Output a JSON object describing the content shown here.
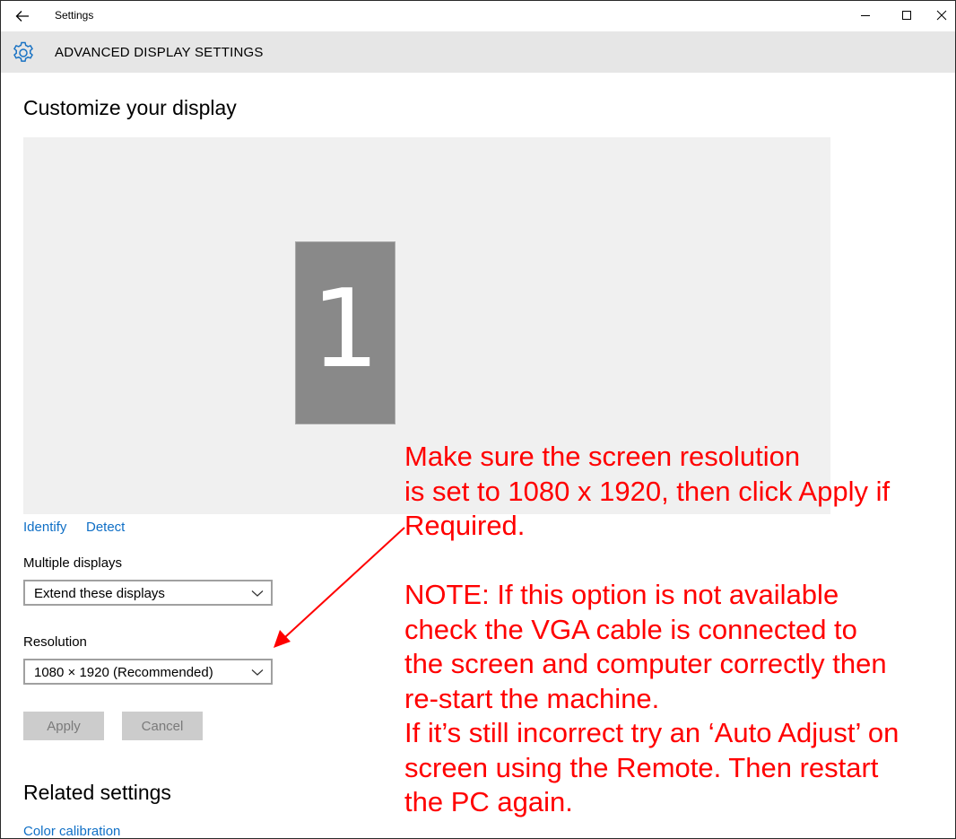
{
  "window": {
    "title": "Settings"
  },
  "header": {
    "title": "ADVANCED DISPLAY SETTINGS"
  },
  "customize": {
    "heading": "Customize your display",
    "monitor_number": "1",
    "identify_label": "Identify",
    "detect_label": "Detect"
  },
  "multiple_displays": {
    "label": "Multiple displays",
    "value": "Extend these displays"
  },
  "resolution": {
    "label": "Resolution",
    "value": "1080 × 1920 (Recommended)"
  },
  "buttons": {
    "apply": "Apply",
    "cancel": "Cancel"
  },
  "related": {
    "heading": "Related settings",
    "color_calibration": "Color calibration"
  },
  "annotation": {
    "lines": [
      "Make sure the screen resolution",
      "is set to 1080 x 1920, then click Apply if",
      "Required.",
      "",
      "NOTE: If this option is not available",
      "check the VGA cable is connected to",
      "the screen and computer correctly then",
      "re-start the machine.",
      "If it’s still incorrect try an ‘Auto Adjust’ on",
      "screen using the Remote. Then restart",
      "the PC again."
    ]
  },
  "colors": {
    "link": "#0f6fc6",
    "header_band": "#e6e6e6",
    "monitor_tile": "#898989",
    "annotation": "#ff0000",
    "disabled_button": "#cccccc"
  },
  "icons": {
    "back": "back-arrow-icon",
    "gear": "gear-icon",
    "minimize": "minimize-icon",
    "maximize": "maximize-icon",
    "close": "close-icon",
    "chevron": "chevron-down-icon"
  }
}
